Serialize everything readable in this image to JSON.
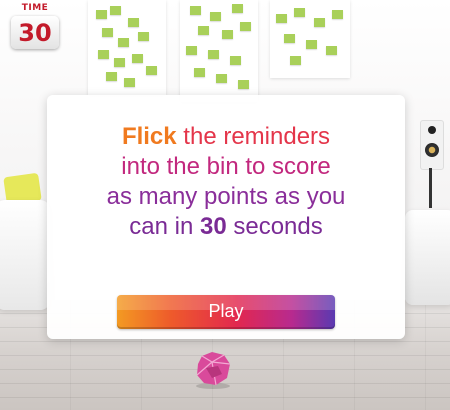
{
  "timer": {
    "label": "TIME",
    "value": "30"
  },
  "dialog": {
    "line1": [
      {
        "text": "Flick",
        "style": "c-orange"
      },
      {
        "text": " the reminders",
        "style": "c-red"
      }
    ],
    "line2": [
      {
        "text": "into the bin to score",
        "style": "c-pink"
      }
    ],
    "line3": [
      {
        "text": "as many points as you",
        "style": "c-purple"
      }
    ],
    "line4": [
      {
        "text": "can in ",
        "style": "c-purple2"
      },
      {
        "text": "30",
        "style": "c-purple2 c-bold"
      },
      {
        "text": " seconds",
        "style": "c-purple2"
      }
    ],
    "play_label": "Play"
  },
  "colors": {
    "accent_red": "#c31a2a",
    "note_green": "#a9d05a",
    "gradient": [
      "#f39a22",
      "#e2284f",
      "#5a3ab1"
    ]
  },
  "icons": {
    "bin": "paper-bin-icon",
    "speaker": "speaker-icon"
  }
}
